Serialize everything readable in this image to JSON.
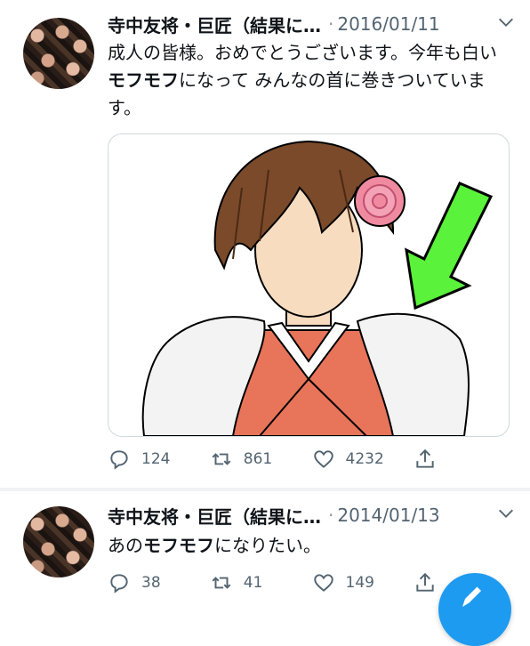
{
  "tweets": [
    {
      "author": "寺中友将・巨匠（結果に…",
      "separator": "·",
      "date": "2016/01/11",
      "text_parts": [
        "成人の皆様。おめでとうございます。今年も白い",
        "モフモフ",
        "になって みんなの首に巻きついています。"
      ],
      "stats": {
        "replies": "124",
        "retweets": "861",
        "likes": "4232"
      }
    },
    {
      "author": "寺中友将・巨匠（結果に…",
      "separator": "·",
      "date": "2014/01/13",
      "text_parts": [
        "あの",
        "モフモフ",
        "になりたい。"
      ],
      "stats": {
        "replies": "38",
        "retweets": "41",
        "likes": "149"
      }
    }
  ],
  "colors": {
    "accent": "#1d9bf0",
    "muted": "#536471",
    "arrow": "#5af23a",
    "kimono": "#e8745a",
    "hair": "#7a4a2a",
    "flower": "#f08aa0"
  },
  "icons": [
    "chevron-down-icon",
    "reply-icon",
    "retweet-icon",
    "like-icon",
    "share-icon",
    "compose-icon"
  ]
}
